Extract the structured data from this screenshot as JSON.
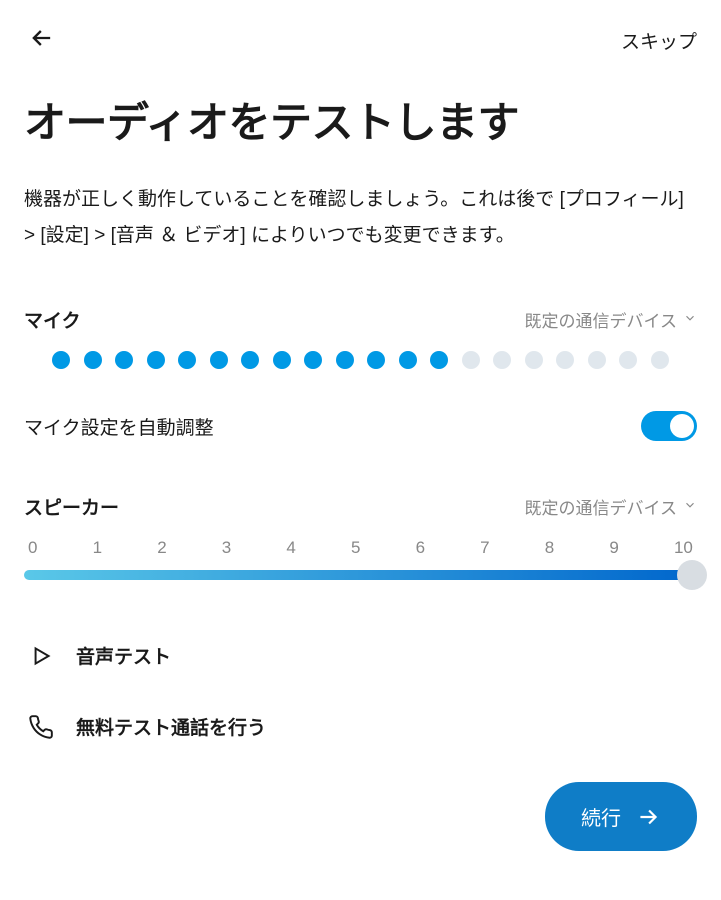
{
  "header": {
    "skip_label": "スキップ"
  },
  "page_title": "オーディオをテストします",
  "description": "機器が正しく動作していることを確認しましょう。これは後で [プロフィール] > [設定] > [音声 ＆ ビデオ] によりいつでも変更できます。",
  "mic": {
    "label": "マイク",
    "device": "既定の通信デバイス",
    "level_dots_total": 20,
    "level_dots_active": 13,
    "auto_adjust_label": "マイク設定を自動調整",
    "auto_adjust_on": true
  },
  "speaker": {
    "label": "スピーカー",
    "device": "既定の通信デバイス",
    "ticks": [
      "0",
      "1",
      "2",
      "3",
      "4",
      "5",
      "6",
      "7",
      "8",
      "9",
      "10"
    ],
    "value": 10,
    "max": 10
  },
  "actions": {
    "sound_test_label": "音声テスト",
    "free_call_label": "無料テスト通話を行う"
  },
  "footer": {
    "continue_label": "続行"
  }
}
